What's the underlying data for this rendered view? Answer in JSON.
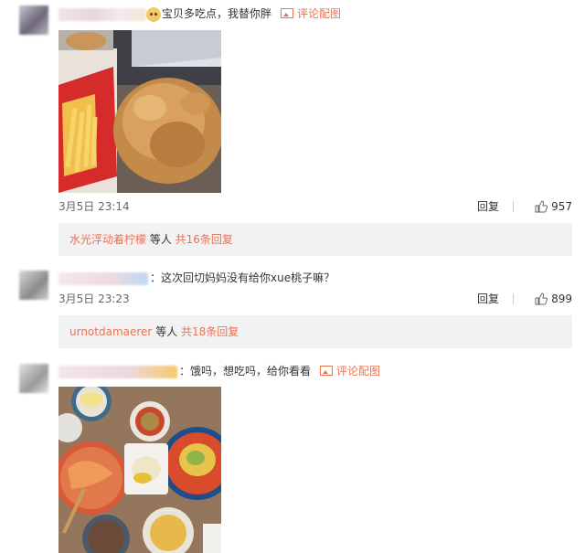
{
  "comments": [
    {
      "text": "宝贝多吃点，我替你胖",
      "pic_link": "评论配图",
      "time": "3月5日 23:14",
      "reply": "回复",
      "likes": "957",
      "sub": {
        "user": "水光浮动着柠檬",
        "mid": " 等人 ",
        "total": "共16条回复"
      }
    },
    {
      "text": "这次回切妈妈没有给你xue桃子嘛？",
      "time": "3月5日 23:23",
      "reply": "回复",
      "likes": "899",
      "sub": {
        "user": "urnotdamaerer",
        "mid": " 等人 ",
        "total": "共18条回复"
      }
    },
    {
      "text": "饿吗，想吃吗，给你看看",
      "pic_link": "评论配图"
    }
  ],
  "colon": "：",
  "colors": {
    "accent": "#eb7350",
    "subbox_bg": "#f2f2f5"
  },
  "icons": {
    "like": "thumbs-up-icon",
    "pic": "image-icon",
    "emoji": "doge-emoji-icon"
  }
}
